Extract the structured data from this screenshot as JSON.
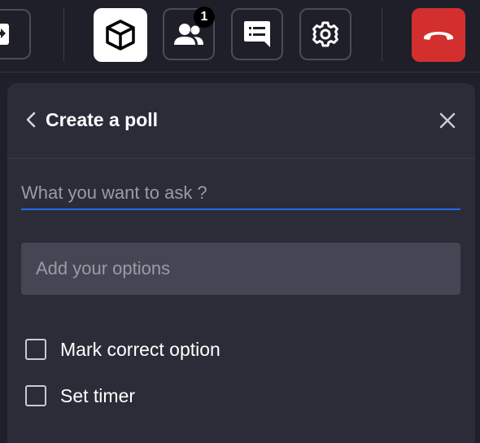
{
  "toolbar": {
    "buttons": [
      {
        "name": "share-screen",
        "icon": "screen-share-icon"
      },
      {
        "name": "whiteboard",
        "icon": "cube-icon",
        "active": true
      },
      {
        "name": "participants",
        "icon": "people-icon",
        "badge": "1"
      },
      {
        "name": "chat",
        "icon": "chat-icon"
      },
      {
        "name": "settings",
        "icon": "gear-icon"
      },
      {
        "name": "end-call",
        "icon": "phone-hangup-icon"
      }
    ],
    "end_call_color": "#d32f2f",
    "active_color": "#ffffff"
  },
  "poll_panel": {
    "title": "Create a poll",
    "question_placeholder": "What you want to ask ?",
    "options_placeholder": "Add your options",
    "mark_correct_label": "Mark correct option",
    "set_timer_label": "Set timer",
    "accent_color": "#1e6be6"
  }
}
